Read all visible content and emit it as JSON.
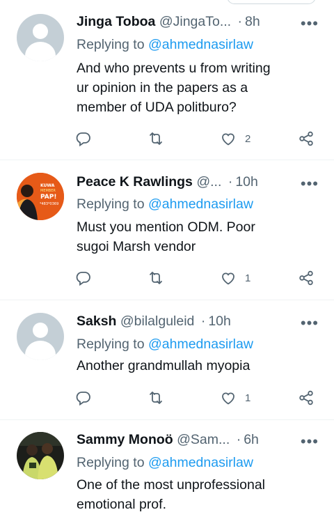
{
  "tweets": [
    {
      "name": "Jinga Toboa",
      "handle": "@JingaTo...",
      "dot": "·",
      "time": "8h",
      "reply_prefix": "Replying to",
      "reply_handle": "@ahmednasirlaw",
      "text_lines": [
        "And who prevents u from writing",
        "ur opinion in the papers as a",
        "member of UDA politburo?"
      ],
      "like_count": "2",
      "avatar": "default-avatar"
    },
    {
      "name": "Peace K Rawlings",
      "handle": "@...",
      "dot": "·",
      "time": "10h",
      "reply_prefix": "Replying to",
      "reply_handle": "@ahmednasirlaw",
      "text_lines": [
        "Must you mention ODM.  Poor",
        "sugoi Marsh vendor"
      ],
      "like_count": "1",
      "avatar": "photo-avatar",
      "avatar_text": [
        "KUWA",
        "MEMBER",
        "PAP!",
        "*483*0369"
      ]
    },
    {
      "name": "Saksh",
      "handle": "@bilalguleid",
      "dot": "·",
      "time": "10h",
      "reply_prefix": "Replying to",
      "reply_handle": "@ahmednasirlaw",
      "text_lines": [
        "Another grandmullah myopia"
      ],
      "like_count": "1",
      "avatar": "default-avatar"
    },
    {
      "name": "Sammy Monoö",
      "handle": "@Sam...",
      "dot": "·",
      "time": "6h",
      "reply_prefix": "Replying to",
      "reply_handle": "@ahmednasirlaw",
      "text_lines": [
        "One of the most unprofessional",
        "emotional prof."
      ],
      "avatar": "photo-avatar"
    }
  ],
  "colors": {
    "link": "#1d9bf0",
    "muted": "#536471",
    "text": "#0f1419",
    "separator": "#eff3f4"
  },
  "icons": [
    "more-icon",
    "reply-icon",
    "retweet-icon",
    "like-icon",
    "share-icon"
  ]
}
